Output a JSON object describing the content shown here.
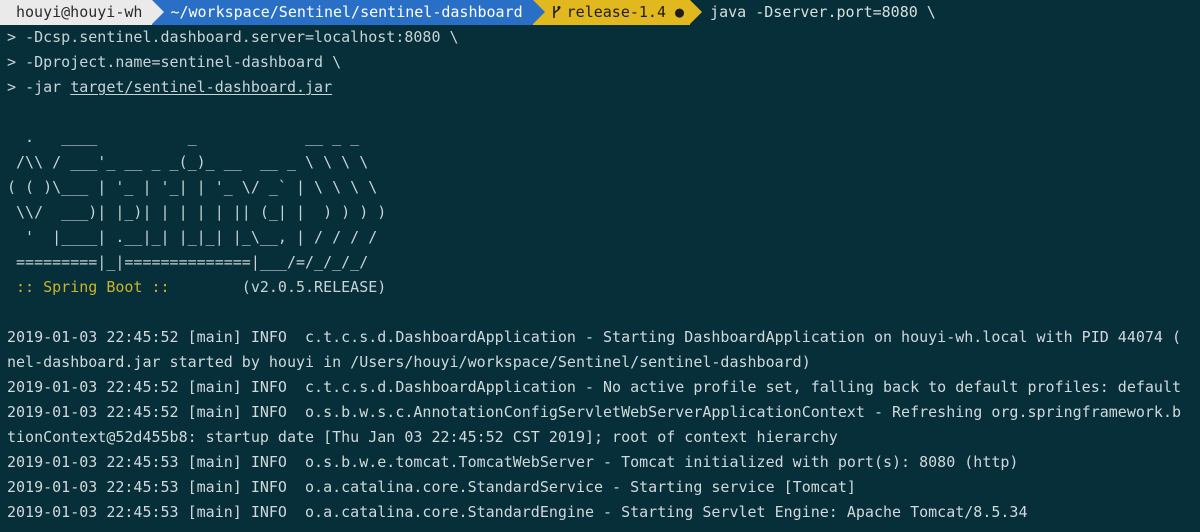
{
  "prompt": {
    "user_host": "houyi@houyi-wh",
    "cwd": "~/workspace/Sentinel/sentinel-dashboard",
    "git_branch": "release-1.4",
    "git_dirty_marker": "●",
    "git_icon": "branch-icon",
    "command": "java -Dserver.port=8080 \\"
  },
  "continuation": [
    {
      "marker": "> ",
      "text": "-Dcsp.sentinel.dashboard.server=localhost:8080 \\"
    },
    {
      "marker": "> ",
      "text": "-Dproject.name=sentinel-dashboard \\"
    },
    {
      "marker": "> ",
      "text": "-jar ",
      "path": "target/sentinel-dashboard.jar"
    }
  ],
  "banner": [
    "  .   ____          _            __ _ _",
    " /\\\\ / ___'_ __ _ _(_)_ __  __ _ \\ \\ \\ \\",
    "( ( )\\___ | '_ | '_| | '_ \\/ _` | \\ \\ \\ \\",
    " \\\\/  ___)| |_)| | | | | || (_| |  ) ) ) )",
    "  '  |____| .__|_| |_|_| |_\\__, | / / / /",
    " =========|_|==============|___/=/_/_/_/"
  ],
  "spring_boot": {
    "label": " :: Spring Boot :: ",
    "version": "       (v2.0.5.RELEASE)"
  },
  "logs": [
    "2019-01-03 22:45:52 [main] INFO  c.t.c.s.d.DashboardApplication - Starting DashboardApplication on houyi-wh.local with PID 44074 (",
    "nel-dashboard.jar started by houyi in /Users/houyi/workspace/Sentinel/sentinel-dashboard)",
    "2019-01-03 22:45:52 [main] INFO  c.t.c.s.d.DashboardApplication - No active profile set, falling back to default profiles: default",
    "2019-01-03 22:45:52 [main] INFO  o.s.b.w.s.c.AnnotationConfigServletWebServerApplicationContext - Refreshing org.springframework.b",
    "tionContext@52d455b8: startup date [Thu Jan 03 22:45:52 CST 2019]; root of context hierarchy",
    "2019-01-03 22:45:53 [main] INFO  o.s.b.w.e.tomcat.TomcatWebServer - Tomcat initialized with port(s): 8080 (http)",
    "2019-01-03 22:45:53 [main] INFO  o.a.catalina.core.StandardService - Starting service [Tomcat]",
    "2019-01-03 22:45:53 [main] INFO  o.a.catalina.core.StandardEngine - Starting Servlet Engine: Apache Tomcat/8.5.34"
  ],
  "colors": {
    "background": "#072f39",
    "segment_user": "#eaeaea",
    "segment_dir": "#2a6fc6",
    "segment_git": "#e1b81e",
    "spring_text": "#c9b42c"
  }
}
